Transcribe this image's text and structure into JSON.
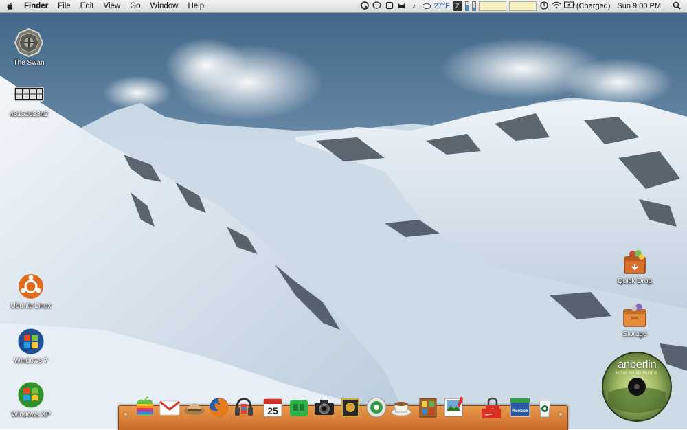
{
  "menubar": {
    "app_name": "Finder",
    "menus": [
      "File",
      "Edit",
      "View",
      "Go",
      "Window",
      "Help"
    ],
    "temperature": "27°F",
    "battery_status": "(Charged)",
    "clock": "Sun 9:00 PM"
  },
  "desktop": {
    "icons_left": [
      {
        "label": "The Swan",
        "icon": "dharma-logo-icon"
      },
      {
        "label": "4815162342",
        "icon": "flip-counter-icon"
      },
      {
        "label": "Ubuntu Linux",
        "icon": "ubuntu-icon"
      },
      {
        "label": "Windows 7",
        "icon": "windows-7-icon"
      },
      {
        "label": "Windows XP",
        "icon": "windows-xp-icon"
      }
    ],
    "icons_right": [
      {
        "label": "Quick Drop",
        "icon": "drop-box-icon"
      },
      {
        "label": "Storage",
        "icon": "storage-box-icon"
      }
    ]
  },
  "album": {
    "band": "anberlin",
    "title": "NEW SURRENDER"
  },
  "dock": {
    "items": [
      "apple-icon",
      "gmail-icon",
      "safari-icon",
      "firefox-icon",
      "itunes-icon",
      "calendar-icon",
      "messages-icon",
      "camera-icon",
      "sticky-icon",
      "finder-icon",
      "coffee-icon",
      "shelf-icon",
      "preview-icon",
      "lock-icon",
      "nike-icon",
      "reebok-icon",
      "coffee-cup-icon"
    ],
    "calendar_day": "25",
    "reebok_label": "Reebok"
  },
  "colors": {
    "dock_wood": "#d8803a",
    "sky": "#6c8fab",
    "snow": "#dfeaf3"
  }
}
